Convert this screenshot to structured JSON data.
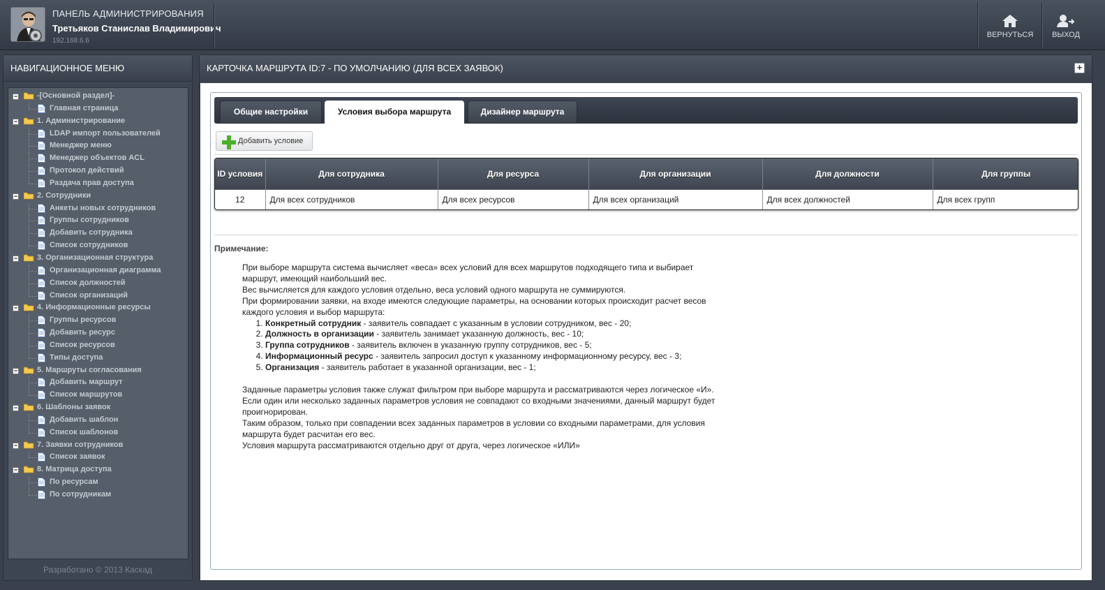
{
  "header": {
    "panel_title": "ПАНЕЛЬ АДМИНИСТРИРОВАНИЯ",
    "user_name": "Третьяков Станислав Владимирович",
    "ip": "192.168.6.6",
    "back_label": "ВЕРНУТЬСЯ",
    "logout_label": "ВЫХОД"
  },
  "sidebar": {
    "title": "НАВИГАЦИОННОЕ МЕНЮ",
    "footer": "Разработано © 2013 Каскад",
    "tree": [
      {
        "label": "-[Основной раздел]-",
        "children": [
          "Главная страница"
        ]
      },
      {
        "label": "1. Администрирование",
        "children": [
          "LDAP импорт пользователей",
          "Менеджер меню",
          "Менеджер объектов ACL",
          "Протокол действий",
          "Раздача прав доступа"
        ]
      },
      {
        "label": "2. Сотрудники",
        "children": [
          "Анкеты новых сотрудников",
          "Группы сотрудников",
          "Добавить сотрудника",
          "Список сотрудников"
        ]
      },
      {
        "label": "3. Организационная структура",
        "children": [
          "Организационная диаграмма",
          "Список должностей",
          "Список организаций"
        ]
      },
      {
        "label": "4. Информационные ресурсы",
        "children": [
          "Группы ресурсов",
          "Добавить ресурс",
          "Список ресурсов",
          "Типы доступа"
        ]
      },
      {
        "label": "5. Маршруты согласования",
        "children": [
          "Добавить маршрут",
          "Список маршрутов"
        ]
      },
      {
        "label": "6. Шаблоны заявок",
        "children": [
          "Добавить шаблон",
          "Список шаблонов"
        ]
      },
      {
        "label": "7. Заявки сотрудников",
        "children": [
          "Список заявок"
        ]
      },
      {
        "label": "8. Матрица доступа",
        "children": [
          "По ресурсам",
          "По сотрудникам"
        ]
      }
    ]
  },
  "main": {
    "title": "КАРТОЧКА МАРШРУТА ID:7 - ПО УМОЛЧАНИЮ (ДЛЯ ВСЕХ ЗАЯВОК)",
    "expand_label": "+",
    "tabs": [
      {
        "label": "Общие настройки",
        "active": false
      },
      {
        "label": "Условия выбора маршрута",
        "active": true
      },
      {
        "label": "Дизайнер маршрута",
        "active": false
      }
    ],
    "add_button": "Добавить условие",
    "table": {
      "headers": [
        "ID условия",
        "Для сотрудника",
        "Для ресурса",
        "Для организации",
        "Для должности",
        "Для группы"
      ],
      "rows": [
        [
          "12",
          "Для всех сотрудников",
          "Для всех ресурсов",
          "Для всех организаций",
          "Для всех должностей",
          "Для всех групп"
        ]
      ]
    },
    "note": {
      "title": "Примечание:",
      "p1": "При выборе маршрута система вычисляет «веса» всех условий для всех маршрутов подходящего типа и выбирает маршрут, имеющий наибольший вес.",
      "p2": "Вес вычисляется для каждого условия отдельно, веса условий одного маршрута не суммируются.",
      "p3": "При формировании заявки, на входе имеются следующие параметры, на основании которых происходит расчет весов каждого условия и выбор маршрута:",
      "items": [
        {
          "bold": "Конкретный сотрудник",
          "text": " - заявитель совпадает с указанным в условии сотрудником, вес - 20;"
        },
        {
          "bold": "Должность в организации",
          "text": " - заявитель занимает указанную должность, вес - 10;"
        },
        {
          "bold": "Группа сотрудников",
          "text": " - заявитель включен в указанную группу сотрудников, вес - 5;"
        },
        {
          "bold": "Информационный ресурс",
          "text": " - заявитель запросил доступ к указанному информационному ресурсу, вес - 3;"
        },
        {
          "bold": "Организация",
          "text": " - заявитель работает в указанной организации, вес - 1;"
        }
      ],
      "p4": "Заданные параметры условия также служат фильтром при выборе маршрута и рассматриваются через логическое «И».",
      "p5": "Если один или несколько заданных параметров условия не совпадают со входными значениями, данный маршрут будет проигнорирован.",
      "p6": "Таким образом, только при совпадении всех заданных параметров в условии со входными параметрами, для условия маршрута будет расчитан его вес.",
      "p7": "Условия маршрута рассматриваются отдельно друг от друга, через логическое «ИЛИ»"
    }
  }
}
